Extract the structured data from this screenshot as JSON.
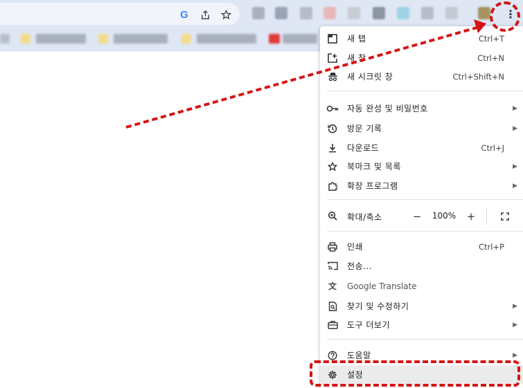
{
  "toolbar": {
    "icons": {
      "google": "G",
      "share": "share-icon",
      "star": "star-icon",
      "menu": "⋮"
    }
  },
  "menu": {
    "items": [
      {
        "id": "new-tab",
        "icon": "new-tab-icon",
        "glyph": "❐",
        "label": "새 탭",
        "shortcut": "Ctrl+T"
      },
      {
        "id": "new-window",
        "icon": "new-window-icon",
        "glyph": "⧉",
        "label": "새 창",
        "shortcut": "Ctrl+N"
      },
      {
        "id": "incognito",
        "icon": "incognito-icon",
        "glyph": "🕶",
        "label": "새 시크릿 창",
        "shortcut": "Ctrl+Shift+N"
      },
      {
        "id": "autofill",
        "icon": "key-icon",
        "glyph": "⚿",
        "label": "자동 완성 및 비밀번호",
        "submenu": true
      },
      {
        "id": "history",
        "icon": "history-icon",
        "glyph": "↺",
        "label": "방문 기록",
        "submenu": true
      },
      {
        "id": "downloads",
        "icon": "download-icon",
        "glyph": "⤓",
        "label": "다운로드",
        "shortcut": "Ctrl+J"
      },
      {
        "id": "bookmarks",
        "icon": "star-icon",
        "glyph": "☆",
        "label": "북마크 및 목록",
        "submenu": true
      },
      {
        "id": "extensions",
        "icon": "puzzle-icon",
        "glyph": "⧠",
        "label": "확장 프로그램",
        "submenu": true
      },
      {
        "id": "print",
        "icon": "printer-icon",
        "glyph": "⎙",
        "label": "인쇄",
        "shortcut": "Ctrl+P"
      },
      {
        "id": "cast",
        "icon": "cast-icon",
        "glyph": "▭",
        "label": "전송..."
      },
      {
        "id": "translate",
        "icon": "translate-icon",
        "glyph": "文",
        "label": "Google Translate"
      },
      {
        "id": "find-edit",
        "icon": "find-file-icon",
        "glyph": "🔍",
        "label": "찾기 및 수정하기",
        "submenu": true
      },
      {
        "id": "more-tools",
        "icon": "toolbox-icon",
        "glyph": "🧰",
        "label": "도구 더보기",
        "submenu": true
      },
      {
        "id": "help",
        "icon": "help-icon",
        "glyph": "?",
        "label": "도움말",
        "submenu": true
      },
      {
        "id": "settings",
        "icon": "gear-icon",
        "glyph": "⚙",
        "label": "설정"
      }
    ],
    "zoom": {
      "label": "확대/축소",
      "minus": "−",
      "value": "100%",
      "plus": "+",
      "fullscreen": "⛶"
    }
  },
  "colors": {
    "toolbar": "#dfe7f5",
    "annotation": "#d41414",
    "highlight": "#ebebeb"
  }
}
